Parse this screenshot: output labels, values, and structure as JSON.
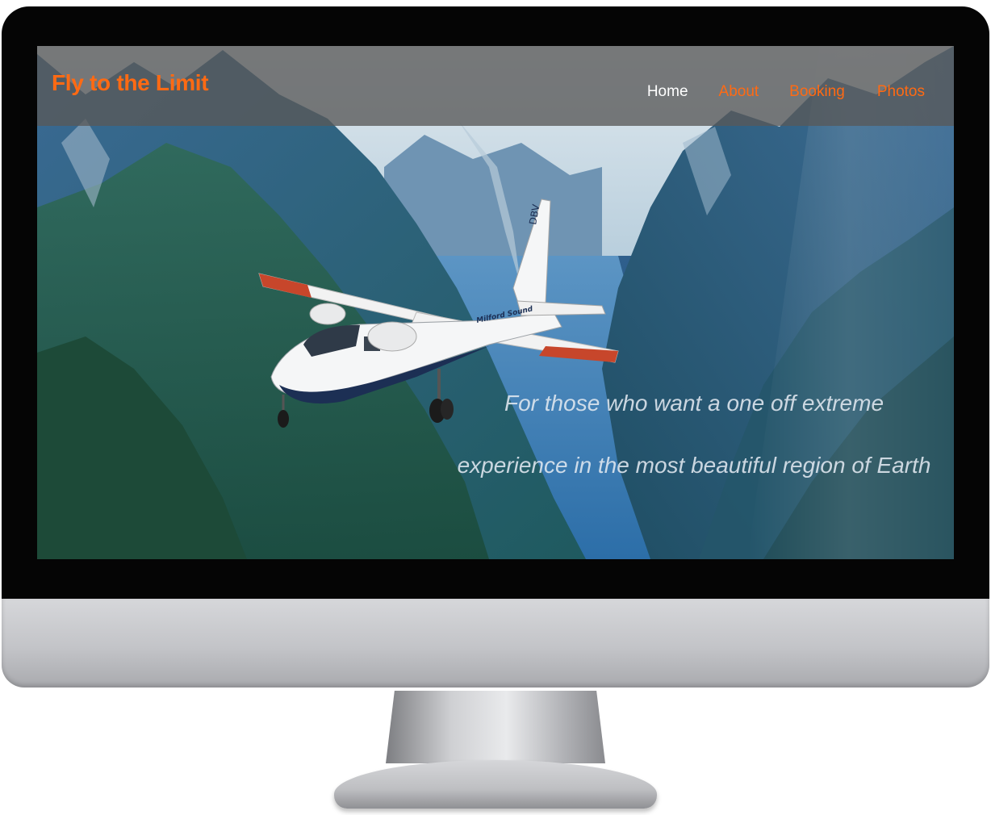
{
  "site": {
    "logo_text": "Fly to the Limit",
    "nav": [
      {
        "label": "Home",
        "active": true
      },
      {
        "label": "About",
        "active": false
      },
      {
        "label": "Booking",
        "active": false
      },
      {
        "label": "Photos",
        "active": false
      }
    ],
    "hero": {
      "tagline": "For those who want a one off extreme experience in the most beautiful region of Earth",
      "aircraft_text": "Milford Sound",
      "tail_code": "DBV"
    }
  },
  "colors": {
    "accent": "#ff6a13",
    "nav_active": "#ffffff",
    "header_bg": "#585858"
  }
}
